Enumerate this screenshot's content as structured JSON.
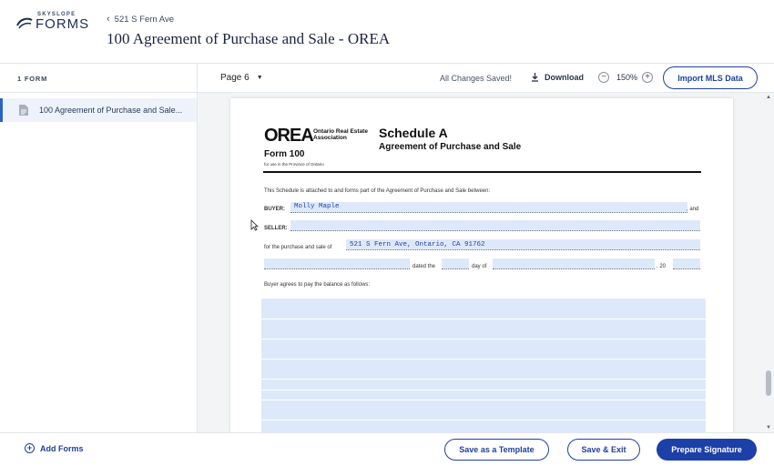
{
  "header": {
    "logo_small": "SKYSLOPE",
    "logo_big": "FORMS",
    "breadcrumb": "521 S Fern Ave",
    "title": "100 Agreement of Purchase and Sale - OREA"
  },
  "sidebar": {
    "heading": "1 FORM",
    "items": [
      {
        "label": "100 Agreement of Purchase and Sale..."
      }
    ]
  },
  "toolbar": {
    "page_label": "Page 6",
    "saved_status": "All Changes Saved!",
    "download_label": "Download",
    "zoom_out": "−",
    "zoom_level": "150%",
    "zoom_in": "+",
    "import_label": "Import MLS Data"
  },
  "document": {
    "orea_logo": "OREA",
    "orea_assoc": "Ontario Real Estate Association",
    "form_number": "Form 100",
    "form_subtitle": "for use in the Province of Ontario",
    "schedule_title": "Schedule A",
    "schedule_subtitle": "Agreement of Purchase and Sale",
    "intro": "This Schedule is attached to and forms part of the Agreement of Purchase and Sale between:",
    "buyer_label": "BUYER:",
    "buyer_value": "Molly Maple",
    "and_text": ", and",
    "seller_label": "SELLER:",
    "seller_value": "",
    "purchase_text": "for the purchase and sale of",
    "property_value": "521 S Fern Ave, Ontario, CA 91762",
    "dated_text": "dated the",
    "day_of_text": "day of",
    "year_text": ", 20",
    "balance_text": "Buyer agrees to pay the balance as follows:"
  },
  "footer": {
    "add_forms": "Add Forms",
    "save_template": "Save as a Template",
    "save_exit": "Save & Exit",
    "prepare_signature": "Prepare Signature"
  },
  "colors": {
    "accent": "#1f3f9e",
    "field_fill": "#dde9fa",
    "selected_bg": "#eef3fb"
  }
}
